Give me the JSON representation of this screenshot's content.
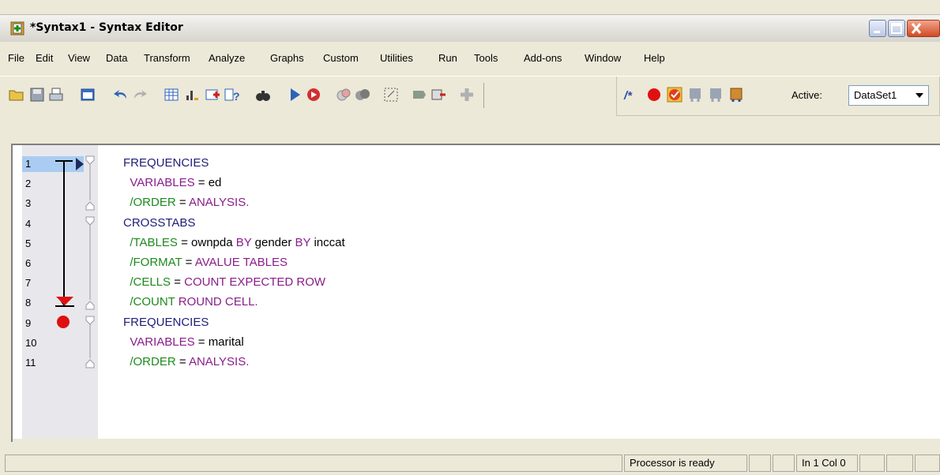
{
  "window": {
    "title": "*Syntax1 - Syntax Editor",
    "minimize_icon": "minimize-icon",
    "maximize_icon": "maximize-icon",
    "close_icon": "close-icon"
  },
  "menu": {
    "items": [
      "File",
      "Edit",
      "View",
      "Data",
      "Transform",
      "Analyze",
      "Graphs",
      "Custom",
      "Utilities",
      "Run",
      "Tools",
      "Add-ons",
      "Window",
      "Help"
    ]
  },
  "toolbar": {
    "active_label": "Active:",
    "dataset_value": "DataSet1"
  },
  "editor": {
    "line_numbers": [
      "1",
      "2",
      "3",
      "4",
      "5",
      "6",
      "7",
      "8",
      "9",
      "10",
      "11"
    ],
    "lines": [
      [
        {
          "t": "FREQUENCIES",
          "c": "kw"
        }
      ],
      [
        {
          "t": "  VARIABLES",
          "c": "val"
        },
        {
          "t": " = ed",
          "c": "plain"
        }
      ],
      [
        {
          "t": "  /ORDER",
          "c": "sub"
        },
        {
          "t": " = ",
          "c": "plain"
        },
        {
          "t": "ANALYSIS.",
          "c": "val"
        }
      ],
      [
        {
          "t": "CROSSTABS",
          "c": "kw"
        }
      ],
      [
        {
          "t": "  /TABLES",
          "c": "sub"
        },
        {
          "t": " = ownpda ",
          "c": "plain"
        },
        {
          "t": "BY",
          "c": "val"
        },
        {
          "t": " gender ",
          "c": "plain"
        },
        {
          "t": "BY",
          "c": "val"
        },
        {
          "t": " inccat",
          "c": "plain"
        }
      ],
      [
        {
          "t": "  /FORMAT",
          "c": "sub"
        },
        {
          "t": " = ",
          "c": "plain"
        },
        {
          "t": "AVALUE TABLES",
          "c": "val"
        }
      ],
      [
        {
          "t": "  /CELLS",
          "c": "sub"
        },
        {
          "t": " = ",
          "c": "plain"
        },
        {
          "t": "COUNT EXPECTED ROW",
          "c": "val"
        }
      ],
      [
        {
          "t": "  /COUNT",
          "c": "sub"
        },
        {
          "t": " ",
          "c": "plain"
        },
        {
          "t": "ROUND CELL.",
          "c": "val"
        }
      ],
      [
        {
          "t": "FREQUENCIES",
          "c": "kw"
        }
      ],
      [
        {
          "t": "  VARIABLES",
          "c": "val"
        },
        {
          "t": " = marital",
          "c": "plain"
        }
      ],
      [
        {
          "t": "  /ORDER",
          "c": "sub"
        },
        {
          "t": " = ",
          "c": "plain"
        },
        {
          "t": "ANALYSIS.",
          "c": "val"
        }
      ]
    ]
  },
  "status": {
    "processor": "Processor is ready",
    "position": "In 1 Col 0"
  },
  "colors": {
    "keyword": "#1d1d78",
    "subcommand": "#1d8a1d",
    "value": "#8a1d8a",
    "breakpoint": "#e01010",
    "current_line": "#aaccf2"
  }
}
